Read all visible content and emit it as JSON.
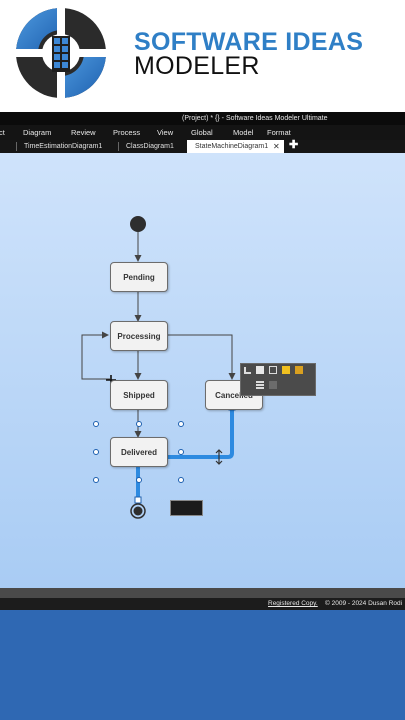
{
  "brand": {
    "line1": "SOFTWARE IDEAS",
    "line2": "MODELER",
    "logo_icon": "sim-logo-icon",
    "accent": "#2f7fc6"
  },
  "window": {
    "title": "(Project) * {} - Software Ideas Modeler Ultimate"
  },
  "menu": {
    "items": [
      "ct",
      "Diagram",
      "Review",
      "Process",
      "View",
      "Global",
      "Model",
      "Format"
    ]
  },
  "tabs": {
    "items": [
      "TimeEstimationDiagram1",
      "ClassDiagram1",
      "StateMachineDiagram1"
    ],
    "active": "StateMachineDiagram1",
    "close_icon": "close-icon",
    "add_icon": "plus-icon"
  },
  "diagram": {
    "states": [
      "Pending",
      "Processing",
      "Shipped",
      "Cancelled",
      "Delivered"
    ],
    "initial_icon": "initial-state-icon",
    "final_icon": "final-state-icon",
    "selected_connector_color": "#2d8ae0"
  },
  "statusbar": {
    "registered": "Registered Copy.",
    "copyright": "© 2009 - 2024 Dusan Rodi"
  }
}
